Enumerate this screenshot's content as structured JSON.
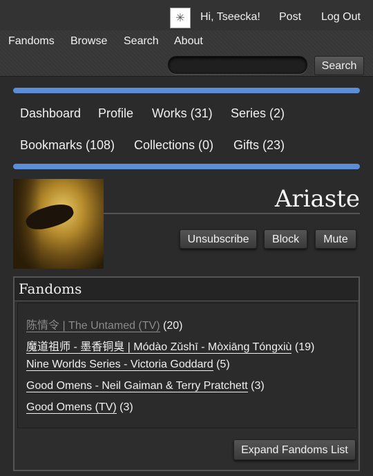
{
  "userbar": {
    "greeting": "Hi, Tseecka!",
    "post": "Post",
    "logout": "Log Out"
  },
  "primary_nav": {
    "items": [
      "Fandoms",
      "Browse",
      "Search",
      "About"
    ],
    "search_button": "Search",
    "search_value": ""
  },
  "dashboard": {
    "items": [
      "Dashboard",
      "Profile",
      "Works (31)",
      "Series (2)",
      "Bookmarks (108)",
      "Collections (0)",
      "Gifts (23)"
    ],
    "accent_color": "#5b8ed6"
  },
  "profile": {
    "username": "Ariaste",
    "buttons": [
      "Unsubscribe",
      "Block",
      "Mute"
    ]
  },
  "fandoms": {
    "heading": "Fandoms",
    "list": [
      {
        "name": "陈情令 | The Untamed (TV)",
        "count": "(20)",
        "visited": true
      },
      {
        "name": "魔道祖师 - 墨香铜臭 | Módào Zǔshī - Mòxiāng Tóngxiù",
        "count": "(19)",
        "visited": false
      },
      {
        "name": "Nine Worlds Series - Victoria Goddard",
        "count": "(5)",
        "visited": false
      },
      {
        "name": "Good Omens - Neil Gaiman & Terry Pratchett",
        "count": "(3)",
        "visited": false
      },
      {
        "name": "Good Omens (TV)",
        "count": "(3)",
        "visited": false
      }
    ],
    "expand_button": "Expand Fandoms List"
  }
}
